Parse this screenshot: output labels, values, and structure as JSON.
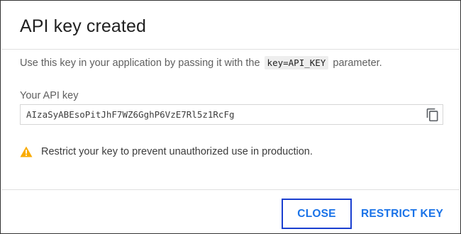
{
  "dialog": {
    "title": "API key created",
    "description_before": "Use this key in your application by passing it with the",
    "description_code": "key=API_KEY",
    "description_after": "parameter.",
    "field_label": "Your API key",
    "api_key": "AIzaSyABEsoPitJhF7WZ6GghP6VzE7Rl5z1RcFg",
    "warning_text": "Restrict your key to prevent unauthorized use in production.",
    "close_label": "CLOSE",
    "restrict_label": "RESTRICT KEY"
  },
  "icons": {
    "copy": "copy-icon",
    "warning": "warning-icon"
  },
  "colors": {
    "accent": "#1a73e8",
    "warning": "#f9ab00",
    "focus_outline": "#1a3fd0"
  }
}
